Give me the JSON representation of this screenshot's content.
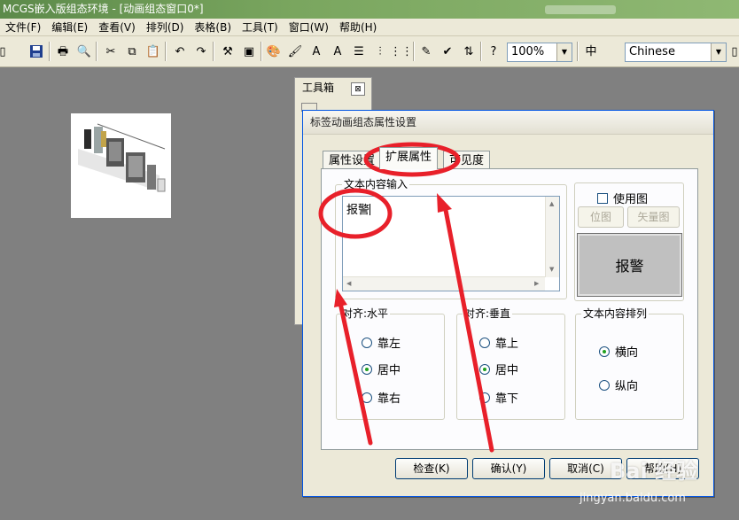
{
  "window": {
    "title": "MCGS嵌入版组态环境 - [动画组态窗口0*]"
  },
  "menu": [
    "文件(F)",
    "编辑(E)",
    "查看(V)",
    "排列(D)",
    "表格(B)",
    "工具(T)",
    "窗口(W)",
    "帮助(H)"
  ],
  "toolbar": {
    "zoom_value": "100%",
    "language_value": "Chinese"
  },
  "toolbox": {
    "title": "工具箱",
    "close_glyph": "⊠"
  },
  "dialog": {
    "title": "标签动画组态属性设置",
    "tabs": [
      "属性设置",
      "扩展属性",
      "可见度"
    ],
    "text_input": {
      "legend": "文本内容输入",
      "value": "报警"
    },
    "use_image": {
      "label": "使用图",
      "checked": false
    },
    "bitmap_button": "位图",
    "vector_button": "矢量图",
    "preview_text": "报警",
    "halign": {
      "legend": "对齐:水平",
      "options": [
        "靠左",
        "居中",
        "靠右"
      ],
      "selected": "居中"
    },
    "valign": {
      "legend": "对齐:垂直",
      "options": [
        "靠上",
        "居中",
        "靠下"
      ],
      "selected": "居中"
    },
    "orient": {
      "legend": "文本内容排列",
      "options": [
        "横向",
        "纵向"
      ],
      "selected": "横向"
    },
    "buttons": [
      "检查(K)",
      "确认(Y)",
      "取消(C)",
      "帮助(H)"
    ]
  },
  "watermark": {
    "brand": "Bai 经验",
    "url": "jingyan.baidu.com"
  },
  "colors": {
    "annotation": "#e8202a",
    "titlebar": "#6f9a56",
    "dialog_bg": "#ece9d8"
  }
}
